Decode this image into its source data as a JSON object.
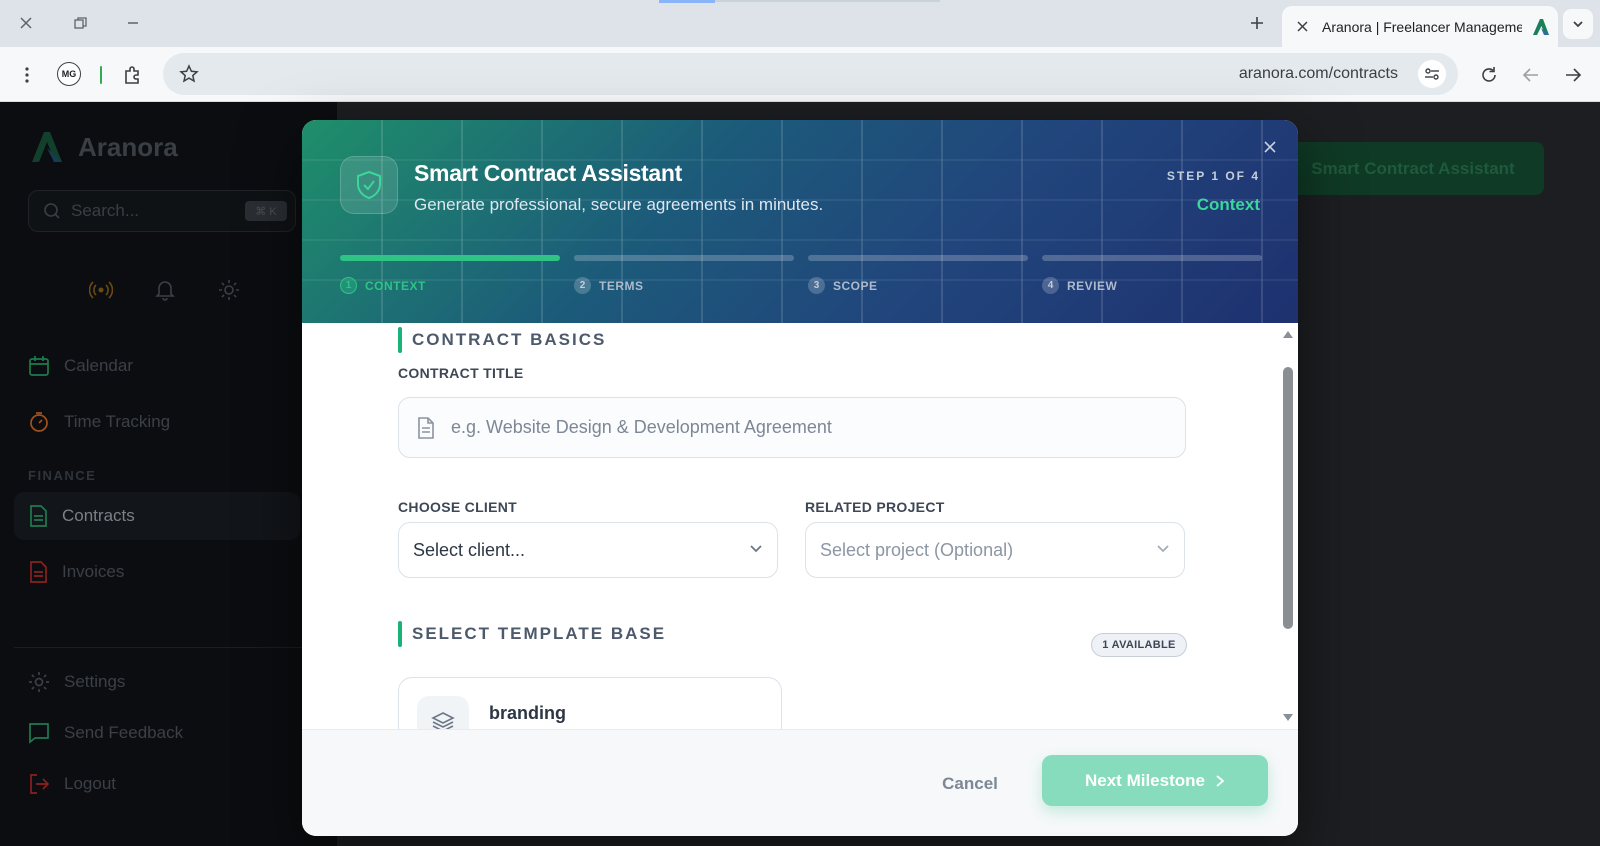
{
  "browser": {
    "tab_title": "Aranora | Freelancer Management",
    "url": "aranora.com/contracts",
    "profile_initials": "MG",
    "new_tab_icon": "plus-icon"
  },
  "sidebar": {
    "brand": "Aranora",
    "search_placeholder": "Search...",
    "search_shortcut": "⌘ K",
    "section_finance": "FINANCE",
    "items": [
      {
        "label": "Calendar",
        "icon": "calendar-icon",
        "color": "#1e7a4f"
      },
      {
        "label": "Time Tracking",
        "icon": "timer-icon",
        "color": "#a0521c"
      },
      {
        "label": "Contracts",
        "icon": "document-icon",
        "color": "#1e7a4f"
      },
      {
        "label": "Invoices",
        "icon": "invoice-icon",
        "color": "#8a2020"
      },
      {
        "label": "Settings",
        "icon": "gear-icon",
        "color": "#3b4047"
      },
      {
        "label": "Send Feedback",
        "icon": "message-icon",
        "color": "#1e7a4f"
      },
      {
        "label": "Logout",
        "icon": "logout-icon",
        "color": "#8a2020"
      }
    ]
  },
  "main": {
    "cta_label": "Smart Contract Assistant"
  },
  "modal": {
    "title": "Smart Contract Assistant",
    "subtitle": "Generate professional, secure agreements in minutes.",
    "step_label": "STEP 1 OF 4",
    "step_name": "Context",
    "steps": [
      {
        "num": "1",
        "label": "CONTEXT",
        "active": true
      },
      {
        "num": "2",
        "label": "TERMS",
        "active": false
      },
      {
        "num": "3",
        "label": "SCOPE",
        "active": false
      },
      {
        "num": "4",
        "label": "REVIEW",
        "active": false
      }
    ],
    "section_basics": "CONTRACT BASICS",
    "contract_title_label": "CONTRACT TITLE",
    "contract_title_placeholder": "e.g. Website Design & Development Agreement",
    "client_label": "CHOOSE CLIENT",
    "client_value": "Select client...",
    "project_label": "RELATED PROJECT",
    "project_value": "Select project (Optional)",
    "section_template": "SELECT TEMPLATE BASE",
    "template_count": "1 AVAILABLE",
    "template_name": "branding",
    "cancel_label": "Cancel",
    "next_label": "Next Milestone",
    "accent": "#2fc486"
  }
}
